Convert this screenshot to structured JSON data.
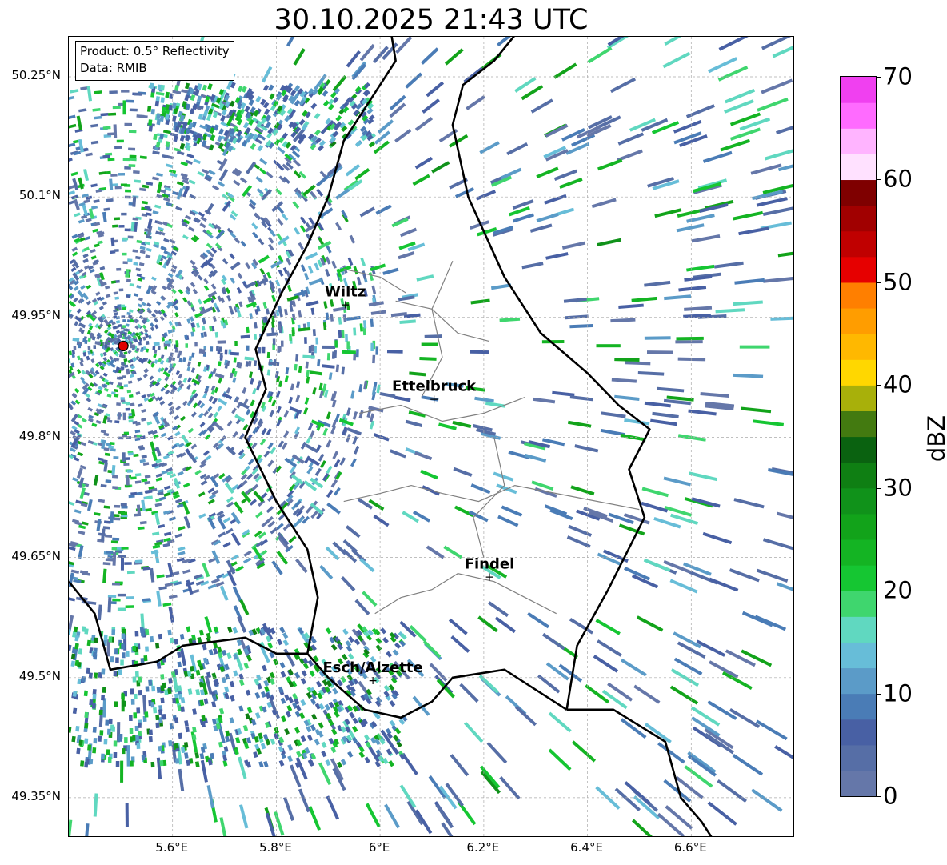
{
  "title": "30.10.2025 21:43 UTC",
  "info": {
    "product": "Product: 0.5° Reflectivity",
    "data": "Data: RMIB"
  },
  "lat_labels": [
    "50.25°N",
    "50.1°N",
    "49.95°N",
    "49.8°N",
    "49.65°N",
    "49.5°N",
    "49.35°N"
  ],
  "lat_values": [
    50.25,
    50.1,
    49.95,
    49.8,
    49.65,
    49.5,
    49.35
  ],
  "lon_labels": [
    "5.6°E",
    "5.8°E",
    "6°E",
    "6.2°E",
    "6.4°E",
    "6.6°E"
  ],
  "lon_values": [
    5.6,
    5.8,
    6.0,
    6.2,
    6.4,
    6.6
  ],
  "extent": {
    "lon_min": 5.4,
    "lon_max": 6.8,
    "lat_min": 49.3,
    "lat_max": 50.3
  },
  "radar_site": {
    "lon": 5.505,
    "lat": 49.914
  },
  "cities": [
    {
      "name": "Wiltz",
      "lon": 5.933,
      "lat": 49.966
    },
    {
      "name": "Ettelbruck",
      "lon": 6.104,
      "lat": 49.848
    },
    {
      "name": "Findel",
      "lon": 6.211,
      "lat": 49.626
    },
    {
      "name": "Esch/Alzette",
      "lon": 5.986,
      "lat": 49.497
    }
  ],
  "colorbar": {
    "label": "dBZ",
    "min": 0,
    "max": 70,
    "step": 2.5,
    "ticks": [
      "0",
      "10",
      "20",
      "30",
      "40",
      "50",
      "60",
      "70"
    ],
    "tick_values": [
      0,
      10,
      20,
      30,
      40,
      50,
      60,
      70
    ],
    "colors": [
      "#6577a9",
      "#566ea6",
      "#4860a4",
      "#4a7cb6",
      "#5b9bc8",
      "#67bdd8",
      "#60d8c0",
      "#3fd66e",
      "#15c632",
      "#14b423",
      "#12a31a",
      "#10921a",
      "#0f7f13",
      "#0a6210",
      "#437a10",
      "#a8b00a",
      "#ffd700",
      "#ffb800",
      "#ff9d00",
      "#ff7f00",
      "#e60000",
      "#c00000",
      "#a10000",
      "#7f0000",
      "#ffe1ff",
      "#ffb4ff",
      "#ff6bff",
      "#f040f0"
    ]
  }
}
